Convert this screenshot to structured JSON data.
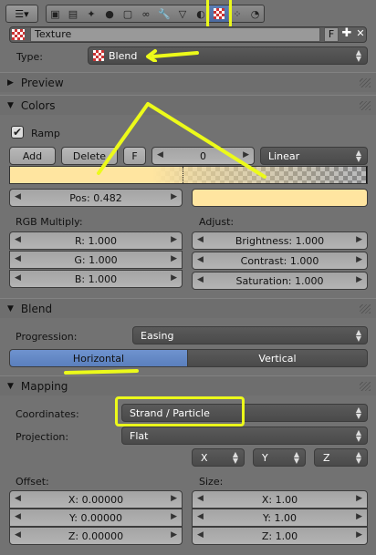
{
  "texture": {
    "name": "Texture",
    "fake_user": "F"
  },
  "type": {
    "label": "Type:",
    "value": "Blend"
  },
  "panels": {
    "preview": "Preview",
    "colors": "Colors",
    "blend": "Blend",
    "mapping": "Mapping"
  },
  "colors": {
    "ramp_label": "Ramp",
    "ramp_enabled": true,
    "add": "Add",
    "delete": "Delete",
    "flip": "F",
    "index": "0",
    "interpolation": "Linear",
    "pos": "Pos: 0.482",
    "stop_color": "#ffe5a0",
    "rgb_multiply_label": "RGB Multiply:",
    "r": "R: 1.000",
    "g": "G: 1.000",
    "b": "B: 1.000",
    "adjust_label": "Adjust:",
    "brightness": "Brightness: 1.000",
    "contrast": "Contrast: 1.000",
    "saturation": "Saturation: 1.000"
  },
  "blend": {
    "progression_label": "Progression:",
    "progression": "Easing",
    "horizontal": "Horizontal",
    "vertical": "Vertical"
  },
  "mapping": {
    "coordinates_label": "Coordinates:",
    "coordinates": "Strand / Particle",
    "projection_label": "Projection:",
    "projection": "Flat",
    "axis_x": "X",
    "axis_y": "Y",
    "axis_z": "Z",
    "offset_label": "Offset:",
    "offset_x": "X: 0.00000",
    "offset_y": "Y: 0.00000",
    "offset_z": "Z: 0.00000",
    "size_label": "Size:",
    "size_x": "X: 1.00",
    "size_y": "Y: 1.00",
    "size_z": "Z: 1.00"
  },
  "colors_theme": {
    "accent": "#5d7fb5",
    "highlight": "#ecfa1a",
    "ramp_color": "#ffe5a0"
  }
}
